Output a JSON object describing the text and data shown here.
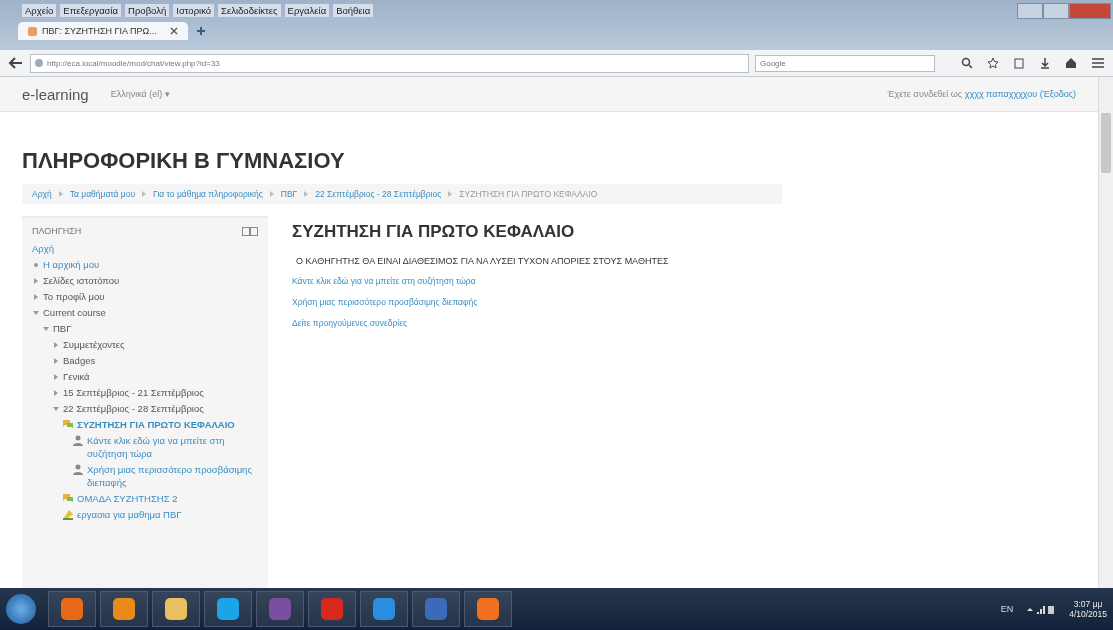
{
  "browser": {
    "menu": [
      "Αρχείο",
      "Επεξεργασία",
      "Προβολή",
      "Ιστορικό",
      "Σελιδοδείκτες",
      "Εργαλεία",
      "Βοήθεια"
    ],
    "tabs": [
      {
        "label": "ΠΒΓ: ΣΥΖΗΤΗΣΗ ΓΙΑ ΠΡΩ...",
        "selected": true
      }
    ],
    "url": "http://eca.local/moodle/mod/chat/view.php?id=33",
    "search": {
      "placeholder": "Google"
    }
  },
  "site": {
    "brand": "e-learning",
    "language": "Ελληνικά (el) ▾",
    "login": "Έχετε συνδεθεί ως ",
    "user": "χχχχ παπαχχχχου",
    "logout": "(Έξοδος)"
  },
  "course_title": "ΠΛΗΡΟΦΟΡΙΚΗ Β ΓΥΜΝΑΣΙΟΥ",
  "breadcrumb": [
    "Αρχή",
    "Τα μαθήματά μου",
    "Για το μάθημα πληροφορικής",
    "ΠΒΓ",
    "22 Σεπτέμβριος - 28 Σεπτέμβριος",
    "ΣΥΖΗΤΗΣΗ ΓΙΑ ΠΡΩΤΟ ΚΕΦΑΛΑΙΟ"
  ],
  "navigation": {
    "title": "ΠΛΟΗΓΗΣΗ",
    "items": [
      {
        "label": "Αρχή",
        "kind": "root",
        "selected": false,
        "children": [
          {
            "label": "Η αρχική μου",
            "kind": "link",
            "selected": false
          },
          {
            "label": "Σελίδες ιστοτόπου",
            "kind": "branch",
            "expanded": false,
            "selected": false
          },
          {
            "label": "Το προφίλ μου",
            "kind": "branch",
            "expanded": false,
            "selected": false
          },
          {
            "label": "Current course",
            "kind": "branch",
            "expanded": true,
            "selected": false,
            "children": [
              {
                "label": "ΠΒΓ",
                "kind": "branch",
                "expanded": true,
                "selected": false,
                "children": [
                  {
                    "label": "Συμμετέχοντες",
                    "kind": "branch",
                    "expanded": false,
                    "selected": false
                  },
                  {
                    "label": "Badges",
                    "kind": "branch",
                    "expanded": false,
                    "selected": false
                  },
                  {
                    "label": "Γενικά",
                    "kind": "branch",
                    "expanded": false,
                    "selected": false
                  },
                  {
                    "label": "15 Σεπτέμβριος - 21 Σεπτέμβριος",
                    "kind": "branch",
                    "expanded": false,
                    "selected": false
                  },
                  {
                    "label": "22 Σεπτέμβριος - 28 Σεπτέμβριος",
                    "kind": "branch",
                    "expanded": true,
                    "selected": false,
                    "children": [
                      {
                        "label": "ΣΥΖΗΤΗΣΗ ΓΙΑ ΠΡΩΤΟ ΚΕΦΑΛΑΙΟ",
                        "kind": "chat",
                        "selected": true,
                        "children": [
                          {
                            "label": "Κάντε κλικ εδώ για να μπείτε στη συζήτηση τώρα",
                            "kind": "user",
                            "selected": false
                          },
                          {
                            "label": "Χρήση μιας περισσότερο προσβάσιμης διεπαφής",
                            "kind": "user",
                            "selected": false
                          }
                        ]
                      },
                      {
                        "label": "ΟΜΑΔΑ ΣΥΖΗΤΗΣΗΣ 2",
                        "kind": "chat",
                        "selected": false
                      },
                      {
                        "label": "εργασια για μαθημα ΠΒΓ",
                        "kind": "assign",
                        "selected": false
                      }
                    ]
                  }
                ]
              }
            ]
          }
        ]
      }
    ]
  },
  "main": {
    "title": "ΣΥΖΗΤΗΣΗ ΓΙΑ ΠΡΩΤΟ ΚΕΦΑΛΑΙΟ",
    "intro": "Ο ΚΑΘΗΓΗΤΗΣ ΘΑ ΕΙΝΑΙ ΔΙΑΘΕΣΙΜΟΣ ΓΙΑ ΝΑ ΛΥΣΕΙ ΤΥΧΟΝ ΑΠΟΡΙΕΣ ΣΤΟΥΣ ΜΑΘΗΤΕΣ",
    "links": [
      "Κάντε κλικ εδώ για να μπείτε στη συζήτηση τώρα",
      "Χρήση μιας περισσότερο προσβάσιμης διεπαφής",
      "Δείτε προηγούμενες συνεδρίες"
    ]
  },
  "taskbar": {
    "language": "EN",
    "time": "3:07 μμ",
    "date": "4/10/2015"
  }
}
